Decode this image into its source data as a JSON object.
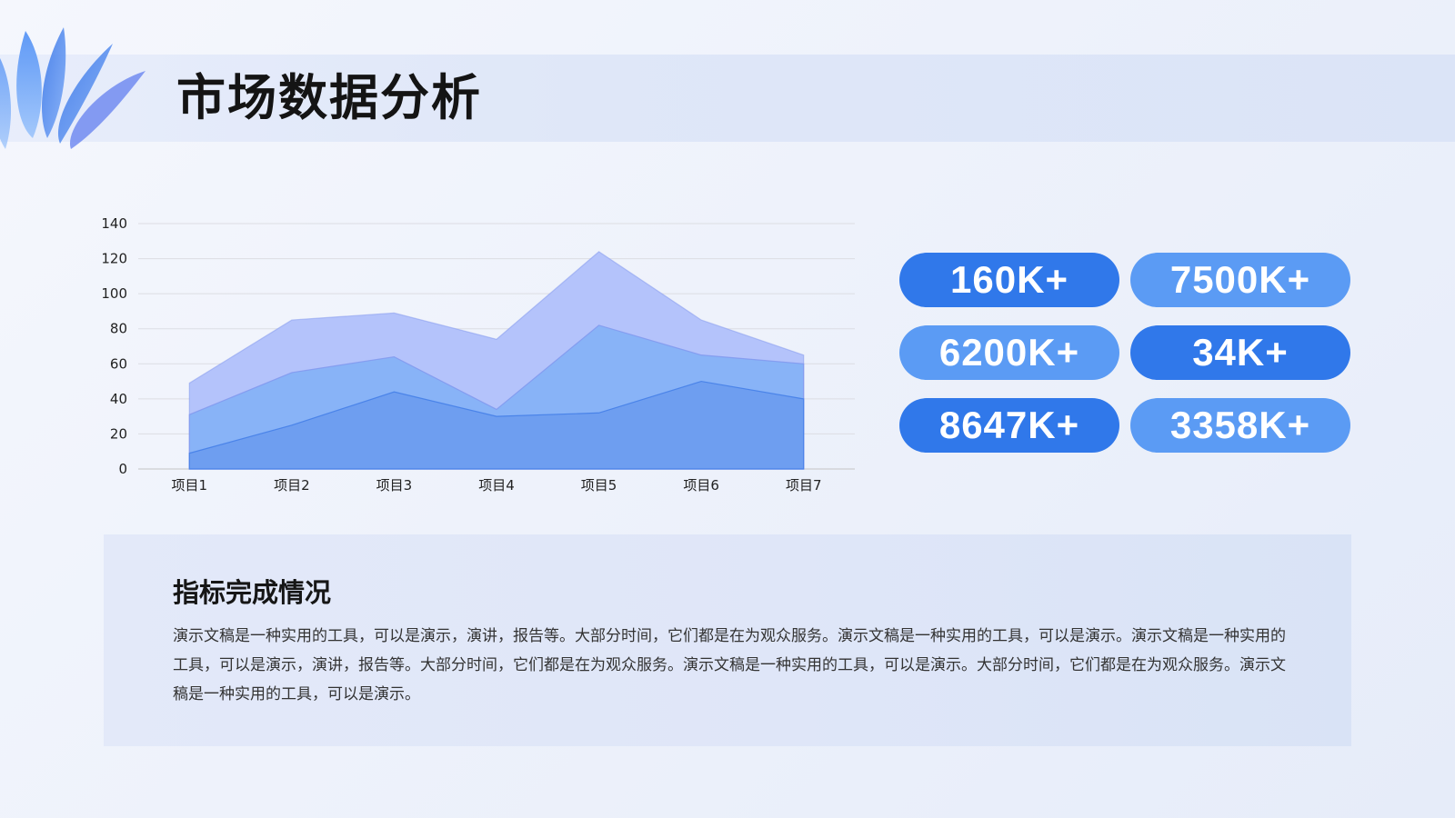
{
  "page": {
    "title": "市场数据分析"
  },
  "chart_data": {
    "type": "area",
    "categories": [
      "项目1",
      "项目2",
      "项目3",
      "项目4",
      "项目5",
      "项目6",
      "项目7"
    ],
    "series": [
      {
        "values": [
          49,
          85,
          89,
          74,
          124,
          85,
          65
        ],
        "color": "#b4c3fb"
      },
      {
        "values": [
          31,
          55,
          64,
          34,
          82,
          65,
          60
        ],
        "color": "#88b3f7"
      },
      {
        "values": [
          9,
          25,
          44,
          30,
          32,
          50,
          40
        ],
        "color": "#6e9ef0"
      }
    ],
    "ylim": [
      0,
      140
    ],
    "yticks": [
      0,
      20,
      40,
      60,
      80,
      100,
      120,
      140
    ],
    "grid": true,
    "xlabel": "",
    "ylabel": ""
  },
  "stats": [
    {
      "value": "160K+",
      "color": "#3078ea"
    },
    {
      "value": "7500K+",
      "color": "#5b9bf4"
    },
    {
      "value": "6200K+",
      "color": "#5b9bf4"
    },
    {
      "value": "34K+",
      "color": "#3078ea"
    },
    {
      "value": "8647K+",
      "color": "#3078ea"
    },
    {
      "value": "3358K+",
      "color": "#5b9bf4"
    }
  ],
  "summary": {
    "title": "指标完成情况",
    "text": "演示文稿是一种实用的工具，可以是演示，演讲，报告等。大部分时间，它们都是在为观众服务。演示文稿是一种实用的工具，可以是演示。演示文稿是一种实用的工具，可以是演示，演讲，报告等。大部分时间，它们都是在为观众服务。演示文稿是一种实用的工具，可以是演示。大部分时间，它们都是在为观众服务。演示文稿是一种实用的工具，可以是演示。"
  }
}
